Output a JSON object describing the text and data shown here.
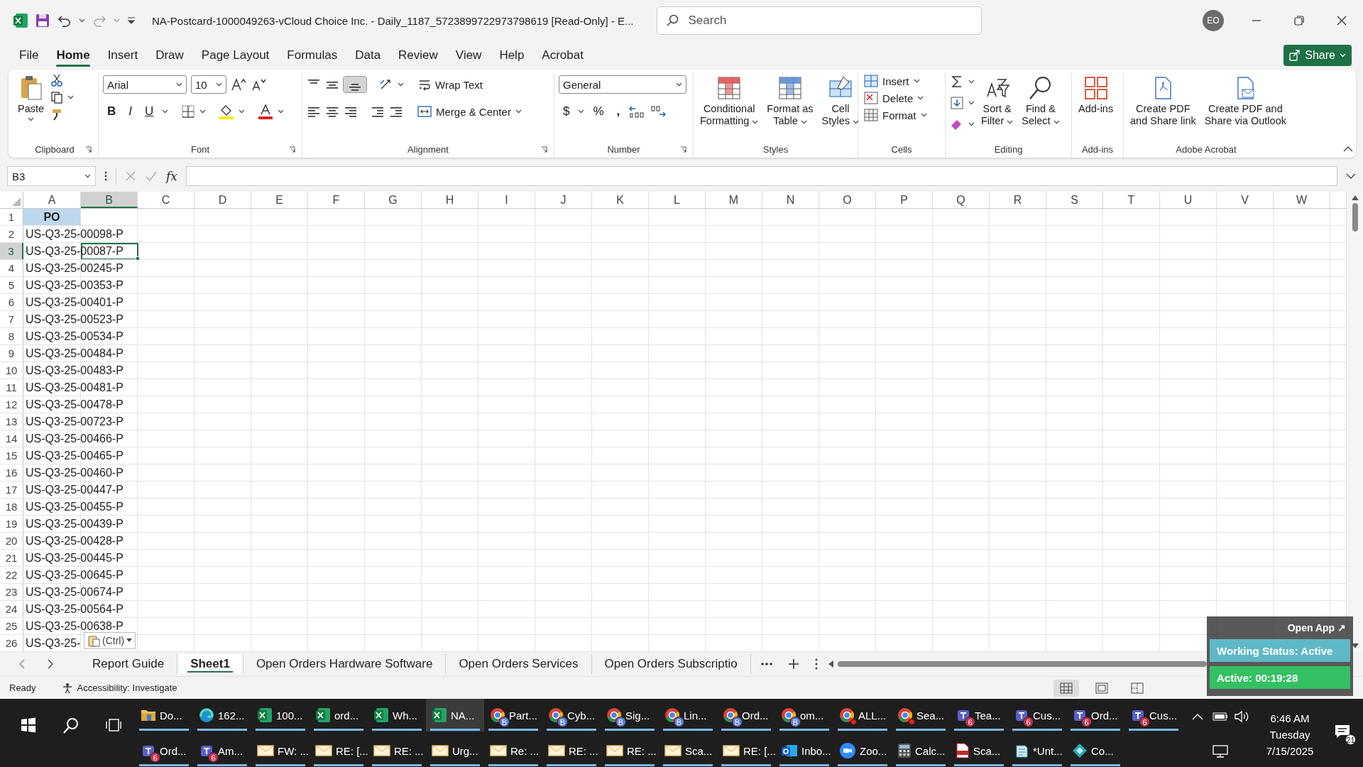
{
  "title_bar": {
    "document_title": "NA-Postcard-1000049263-vCloud Choice Inc. - Daily_1187_5723899722973798619  [Read-Only]  -  E...",
    "search_placeholder": "Search",
    "user_initials": "EO"
  },
  "menu_tabs": [
    {
      "label": "File",
      "selected": false
    },
    {
      "label": "Home",
      "selected": true
    },
    {
      "label": "Insert",
      "selected": false
    },
    {
      "label": "Draw",
      "selected": false
    },
    {
      "label": "Page Layout",
      "selected": false
    },
    {
      "label": "Formulas",
      "selected": false
    },
    {
      "label": "Data",
      "selected": false
    },
    {
      "label": "Review",
      "selected": false
    },
    {
      "label": "View",
      "selected": false
    },
    {
      "label": "Help",
      "selected": false
    },
    {
      "label": "Acrobat",
      "selected": false
    }
  ],
  "share_button": "Share",
  "ribbon": {
    "clipboard": {
      "label": "Clipboard",
      "paste": "Paste"
    },
    "font": {
      "label": "Font",
      "name": "Arial",
      "size": "10",
      "styles": [
        "B",
        "I",
        "U"
      ]
    },
    "alignment": {
      "label": "Alignment",
      "wrap_text": "Wrap Text",
      "merge": "Merge & Center",
      "bottom_align_selected": true
    },
    "number": {
      "label": "Number",
      "format": "General",
      "symbols": [
        "$",
        "%",
        ","
      ]
    },
    "styles": {
      "label": "Styles",
      "buttons": [
        "Conditional\nFormatting",
        "Format as\nTable",
        "Cell\nStyles"
      ]
    },
    "cells": {
      "label": "Cells",
      "buttons": [
        "Insert",
        "Delete",
        "Format"
      ]
    },
    "editing": {
      "label": "Editing",
      "buttons": [
        "Sort &\nFilter",
        "Find &\nSelect"
      ]
    },
    "addins": {
      "label": "Add-ins",
      "buttons": [
        "Add-ins"
      ]
    },
    "acrobat": {
      "label": "Adobe Acrobat",
      "buttons": [
        "Create PDF\nand Share link",
        "Create PDF and\nShare via Outlook"
      ]
    }
  },
  "formula_bar": {
    "name_box": "B3",
    "function_label": "fx"
  },
  "grid": {
    "columns": [
      {
        "label": "A",
        "selected": false
      },
      {
        "label": "B",
        "selected": true
      },
      {
        "label": "C",
        "selected": false
      },
      {
        "label": "D",
        "selected": false
      },
      {
        "label": "E",
        "selected": false
      },
      {
        "label": "F",
        "selected": false
      },
      {
        "label": "G",
        "selected": false
      },
      {
        "label": "H",
        "selected": false
      },
      {
        "label": "I",
        "selected": false
      },
      {
        "label": "J",
        "selected": false
      },
      {
        "label": "K",
        "selected": false
      },
      {
        "label": "L",
        "selected": false
      },
      {
        "label": "M",
        "selected": false
      },
      {
        "label": "N",
        "selected": false
      },
      {
        "label": "O",
        "selected": false
      },
      {
        "label": "P",
        "selected": false
      },
      {
        "label": "Q",
        "selected": false
      },
      {
        "label": "R",
        "selected": false
      },
      {
        "label": "S",
        "selected": false
      },
      {
        "label": "T",
        "selected": false
      },
      {
        "label": "U",
        "selected": false
      },
      {
        "label": "V",
        "selected": false
      },
      {
        "label": "W",
        "selected": false
      }
    ],
    "rows": [
      {
        "number": "1",
        "value": "PO",
        "kind": "header",
        "selected": false
      },
      {
        "number": "2",
        "value": "US-Q3-25-00098-P",
        "kind": "data",
        "selected": false
      },
      {
        "number": "3",
        "value": "US-Q3-25-00087-P",
        "kind": "data",
        "selected": true
      },
      {
        "number": "4",
        "value": "US-Q3-25-00245-P",
        "kind": "data",
        "selected": false
      },
      {
        "number": "5",
        "value": "US-Q3-25-00353-P",
        "kind": "data",
        "selected": false
      },
      {
        "number": "6",
        "value": "US-Q3-25-00401-P",
        "kind": "data",
        "selected": false
      },
      {
        "number": "7",
        "value": "US-Q3-25-00523-P",
        "kind": "data",
        "selected": false
      },
      {
        "number": "8",
        "value": "US-Q3-25-00534-P",
        "kind": "data",
        "selected": false
      },
      {
        "number": "9",
        "value": "US-Q3-25-00484-P",
        "kind": "data",
        "selected": false
      },
      {
        "number": "10",
        "value": "US-Q3-25-00483-P",
        "kind": "data",
        "selected": false
      },
      {
        "number": "11",
        "value": "US-Q3-25-00481-P",
        "kind": "data",
        "selected": false
      },
      {
        "number": "12",
        "value": "US-Q3-25-00478-P",
        "kind": "data",
        "selected": false
      },
      {
        "number": "13",
        "value": "US-Q3-25-00723-P",
        "kind": "data",
        "selected": false
      },
      {
        "number": "14",
        "value": "US-Q3-25-00466-P",
        "kind": "data",
        "selected": false
      },
      {
        "number": "15",
        "value": "US-Q3-25-00465-P",
        "kind": "data",
        "selected": false
      },
      {
        "number": "16",
        "value": "US-Q3-25-00460-P",
        "kind": "data",
        "selected": false
      },
      {
        "number": "17",
        "value": "US-Q3-25-00447-P",
        "kind": "data",
        "selected": false
      },
      {
        "number": "18",
        "value": "US-Q3-25-00455-P",
        "kind": "data",
        "selected": false
      },
      {
        "number": "19",
        "value": "US-Q3-25-00439-P",
        "kind": "data",
        "selected": false
      },
      {
        "number": "20",
        "value": "US-Q3-25-00428-P",
        "kind": "data",
        "selected": false
      },
      {
        "number": "21",
        "value": "US-Q3-25-00445-P",
        "kind": "data",
        "selected": false
      },
      {
        "number": "22",
        "value": "US-Q3-25-00645-P",
        "kind": "data",
        "selected": false
      },
      {
        "number": "23",
        "value": "US-Q3-25-00674-P",
        "kind": "data",
        "selected": false
      },
      {
        "number": "24",
        "value": "US-Q3-25-00564-P",
        "kind": "data",
        "selected": false
      },
      {
        "number": "25",
        "value": "US-Q3-25-00638-P",
        "kind": "data",
        "selected": false
      },
      {
        "number": "26",
        "value": "US-Q3-25-",
        "kind": "data",
        "selected": false
      }
    ],
    "paste_options": "(Ctrl)"
  },
  "sheet_tabs": [
    {
      "label": "Report Guide",
      "selected": false
    },
    {
      "label": "Sheet1",
      "selected": true
    },
    {
      "label": "Open Orders Hardware Software",
      "selected": false
    },
    {
      "label": "Open Orders Services",
      "selected": false
    },
    {
      "label": "Open Orders Subscriptio",
      "selected": false
    }
  ],
  "status_bar": {
    "mode": "Ready",
    "accessibility": "Accessibility: Investigate",
    "views": [
      {
        "kind": "normal",
        "selected": true
      },
      {
        "kind": "page_layout",
        "selected": false
      },
      {
        "kind": "page_break",
        "selected": false
      }
    ]
  },
  "tracker": {
    "open_app": "Open App ↗",
    "status": "Working Status: Active",
    "timer": "Active: 00:19:28"
  },
  "taskbar": {
    "rows": [
      [
        {
          "kind": "folder",
          "label": "Do...",
          "selected": false,
          "alert": false
        },
        {
          "kind": "edge",
          "label": "162...",
          "selected": false,
          "alert": false
        },
        {
          "kind": "excel",
          "label": "100...",
          "selected": false,
          "alert": false
        },
        {
          "kind": "excel",
          "label": "ord...",
          "selected": false,
          "alert": false
        },
        {
          "kind": "excel",
          "label": "Wh...",
          "selected": false,
          "alert": false
        },
        {
          "kind": "excel",
          "label": "NA...",
          "selected": true,
          "alert": false
        },
        {
          "kind": "chrome",
          "label": "Part...",
          "badge": "B",
          "selected": false,
          "alert": false
        },
        {
          "kind": "chrome",
          "label": "Cyb...",
          "badge": "B",
          "selected": false,
          "alert": false
        },
        {
          "kind": "chrome",
          "label": "Sig...",
          "badge": "B",
          "selected": false,
          "alert": false
        },
        {
          "kind": "chrome",
          "label": "Lin...",
          "badge": "B",
          "selected": false,
          "alert": false
        },
        {
          "kind": "chrome",
          "label": "Ord...",
          "badge": "B",
          "selected": false,
          "alert": false
        },
        {
          "kind": "chrome",
          "label": "om...",
          "badge": "B",
          "selected": false,
          "alert": false
        },
        {
          "kind": "chrome",
          "label": "ALL...",
          "selected": false,
          "alert": true
        },
        {
          "kind": "chrome",
          "label": "Sea...",
          "selected": false,
          "alert": true
        },
        {
          "kind": "teams",
          "label": "Tea...",
          "badge": "6",
          "selected": false,
          "alert": false
        },
        {
          "kind": "teams",
          "label": "Cus...",
          "badge": "6",
          "selected": false,
          "alert": false
        },
        {
          "kind": "teams",
          "label": "Ord...",
          "badge": "6",
          "selected": false,
          "alert": false
        },
        {
          "kind": "teams",
          "label": "Cus...",
          "badge": "6",
          "selected": false,
          "alert": false
        }
      ],
      [
        {
          "kind": "teams",
          "label": "Ord...",
          "badge": "6",
          "selected": false,
          "alert": false
        },
        {
          "kind": "teams",
          "label": "Am...",
          "badge": "6",
          "selected": false,
          "alert": false
        },
        {
          "kind": "mail",
          "label": "FW: ...",
          "selected": false,
          "alert": false
        },
        {
          "kind": "mail",
          "label": "RE: [...",
          "selected": false,
          "alert": false
        },
        {
          "kind": "mail",
          "label": "RE: ...",
          "selected": false,
          "alert": false
        },
        {
          "kind": "mail",
          "label": "Urg...",
          "selected": false,
          "alert": false
        },
        {
          "kind": "mail",
          "label": "Re: ...",
          "selected": false,
          "alert": false
        },
        {
          "kind": "mail",
          "label": "RE: ...",
          "selected": false,
          "alert": false
        },
        {
          "kind": "mail",
          "label": "RE: ...",
          "selected": false,
          "alert": false
        },
        {
          "kind": "mail",
          "label": "Sca...",
          "selected": false,
          "alert": false
        },
        {
          "kind": "mail",
          "label": "RE: [...",
          "selected": false,
          "alert": false
        },
        {
          "kind": "outlook",
          "label": "Inbo...",
          "selected": false,
          "alert": false
        },
        {
          "kind": "zoom",
          "label": "Zoo...",
          "selected": false,
          "alert": false
        },
        {
          "kind": "calculator",
          "label": "Calc...",
          "selected": false,
          "alert": false
        },
        {
          "kind": "pdf",
          "label": "Sca...",
          "selected": false,
          "alert": false
        },
        {
          "kind": "notepad",
          "label": "*Unt...",
          "selected": false,
          "alert": false
        },
        {
          "kind": "diamond",
          "label": "Co...",
          "selected": false,
          "alert": false
        }
      ]
    ],
    "clock": {
      "time": "6:46 AM",
      "day": "Tuesday",
      "date": "7/15/2025"
    },
    "notifications": "21"
  }
}
